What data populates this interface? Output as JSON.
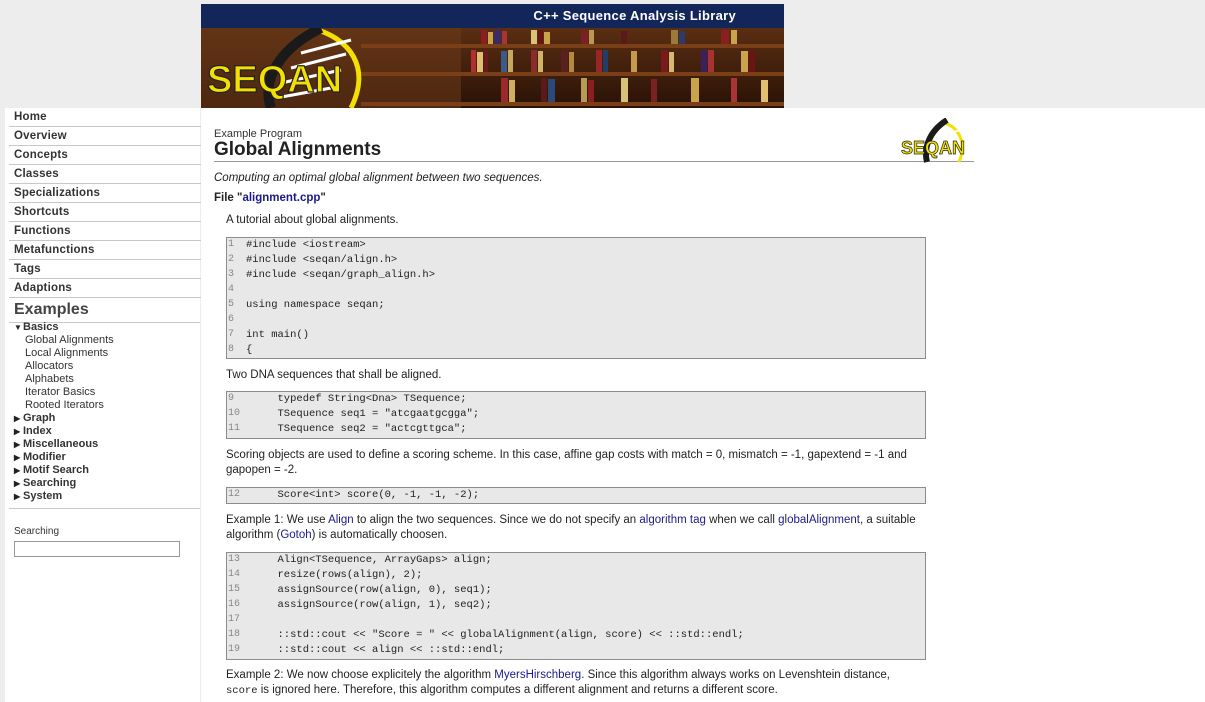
{
  "banner": {
    "title": "C++ Sequence Analysis Library",
    "logo_text": "SEQAN"
  },
  "nav": {
    "items": [
      {
        "label": "Home"
      },
      {
        "label": "Overview"
      },
      {
        "label": "Concepts"
      },
      {
        "label": "Classes"
      },
      {
        "label": "Specializations"
      },
      {
        "label": "Shortcuts"
      },
      {
        "label": "Functions"
      },
      {
        "label": "Metafunctions"
      },
      {
        "label": "Tags"
      },
      {
        "label": "Adaptions"
      }
    ],
    "examples_title": "Examples",
    "tree": {
      "basics": "Basics",
      "basics_items": [
        "Global Alignments",
        "Local Alignments",
        "Allocators",
        "Alphabets",
        "Iterator Basics",
        "Rooted Iterators"
      ],
      "groups": [
        "Graph",
        "Index",
        "Miscellaneous",
        "Modifier",
        "Motif Search",
        "Searching",
        "System"
      ]
    },
    "search_label": "Searching",
    "search_value": ""
  },
  "main": {
    "crumb": "Example Program",
    "title": "Global Alignments",
    "mini_logo_text": "SEQAN",
    "subtitle": "Computing an optimal global alignment between two sequences.",
    "file_prefix": "File \"",
    "file_name": "alignment.cpp",
    "file_suffix": "\"",
    "intro": "A tutorial about global alignments.",
    "code1": [
      {
        "n": "1",
        "t": "#include <iostream>"
      },
      {
        "n": "2",
        "t": "#include <seqan/align.h>"
      },
      {
        "n": "3",
        "t": "#include <seqan/graph_align.h>"
      },
      {
        "n": "4",
        "t": ""
      },
      {
        "n": "5",
        "t": "using namespace seqan;"
      },
      {
        "n": "6",
        "t": ""
      },
      {
        "n": "7",
        "t": "int main()"
      },
      {
        "n": "8",
        "t": "{"
      }
    ],
    "para2": "Two DNA sequences that shall be aligned.",
    "code2": [
      {
        "n": "9",
        "t": "     typedef String<Dna> TSequence;"
      },
      {
        "n": "10",
        "t": "     TSequence seq1 = \"atcgaatgcgga\";"
      },
      {
        "n": "11",
        "t": "     TSequence seq2 = \"actcgttgca\";"
      }
    ],
    "para3": "Scoring objects are used to define a scoring scheme. In this case, affine gap costs with match = 0, mismatch = -1, gapextend = -1 and gapopen = -2.",
    "code3": [
      {
        "n": "12",
        "t": "     Score<int> score(0, -1, -1, -2);"
      }
    ],
    "para4": {
      "a": "Example 1: We use ",
      "link1": "Align",
      "b": " to align the two sequences. Since we do not specify an ",
      "link2": "algorithm tag",
      "c": " when we call ",
      "link3": "globalAlignment",
      "d": ", a suitable algorithm (",
      "link4": "Gotoh",
      "e": ") is automatically choosen."
    },
    "code4": [
      {
        "n": "13",
        "t": "     Align<TSequence, ArrayGaps> align;"
      },
      {
        "n": "14",
        "t": "     resize(rows(align), 2);"
      },
      {
        "n": "15",
        "t": "     assignSource(row(align, 0), seq1);"
      },
      {
        "n": "16",
        "t": "     assignSource(row(align, 1), seq2);"
      },
      {
        "n": "17",
        "t": ""
      },
      {
        "n": "18",
        "t": "     ::std::cout << \"Score = \" << globalAlignment(align, score) << ::std::endl;"
      },
      {
        "n": "19",
        "t": "     ::std::cout << align << ::std::endl;"
      }
    ],
    "para5": {
      "a": "Example 2: We now choose explicitely the algorithm ",
      "link1": "MyersHirschberg",
      "b": ". Since this algorithm always works on Levenshtein distance, ",
      "code": "score",
      "c": " is ignored here. Therefore, this algorithm computes a different alignment and returns a different score."
    }
  }
}
